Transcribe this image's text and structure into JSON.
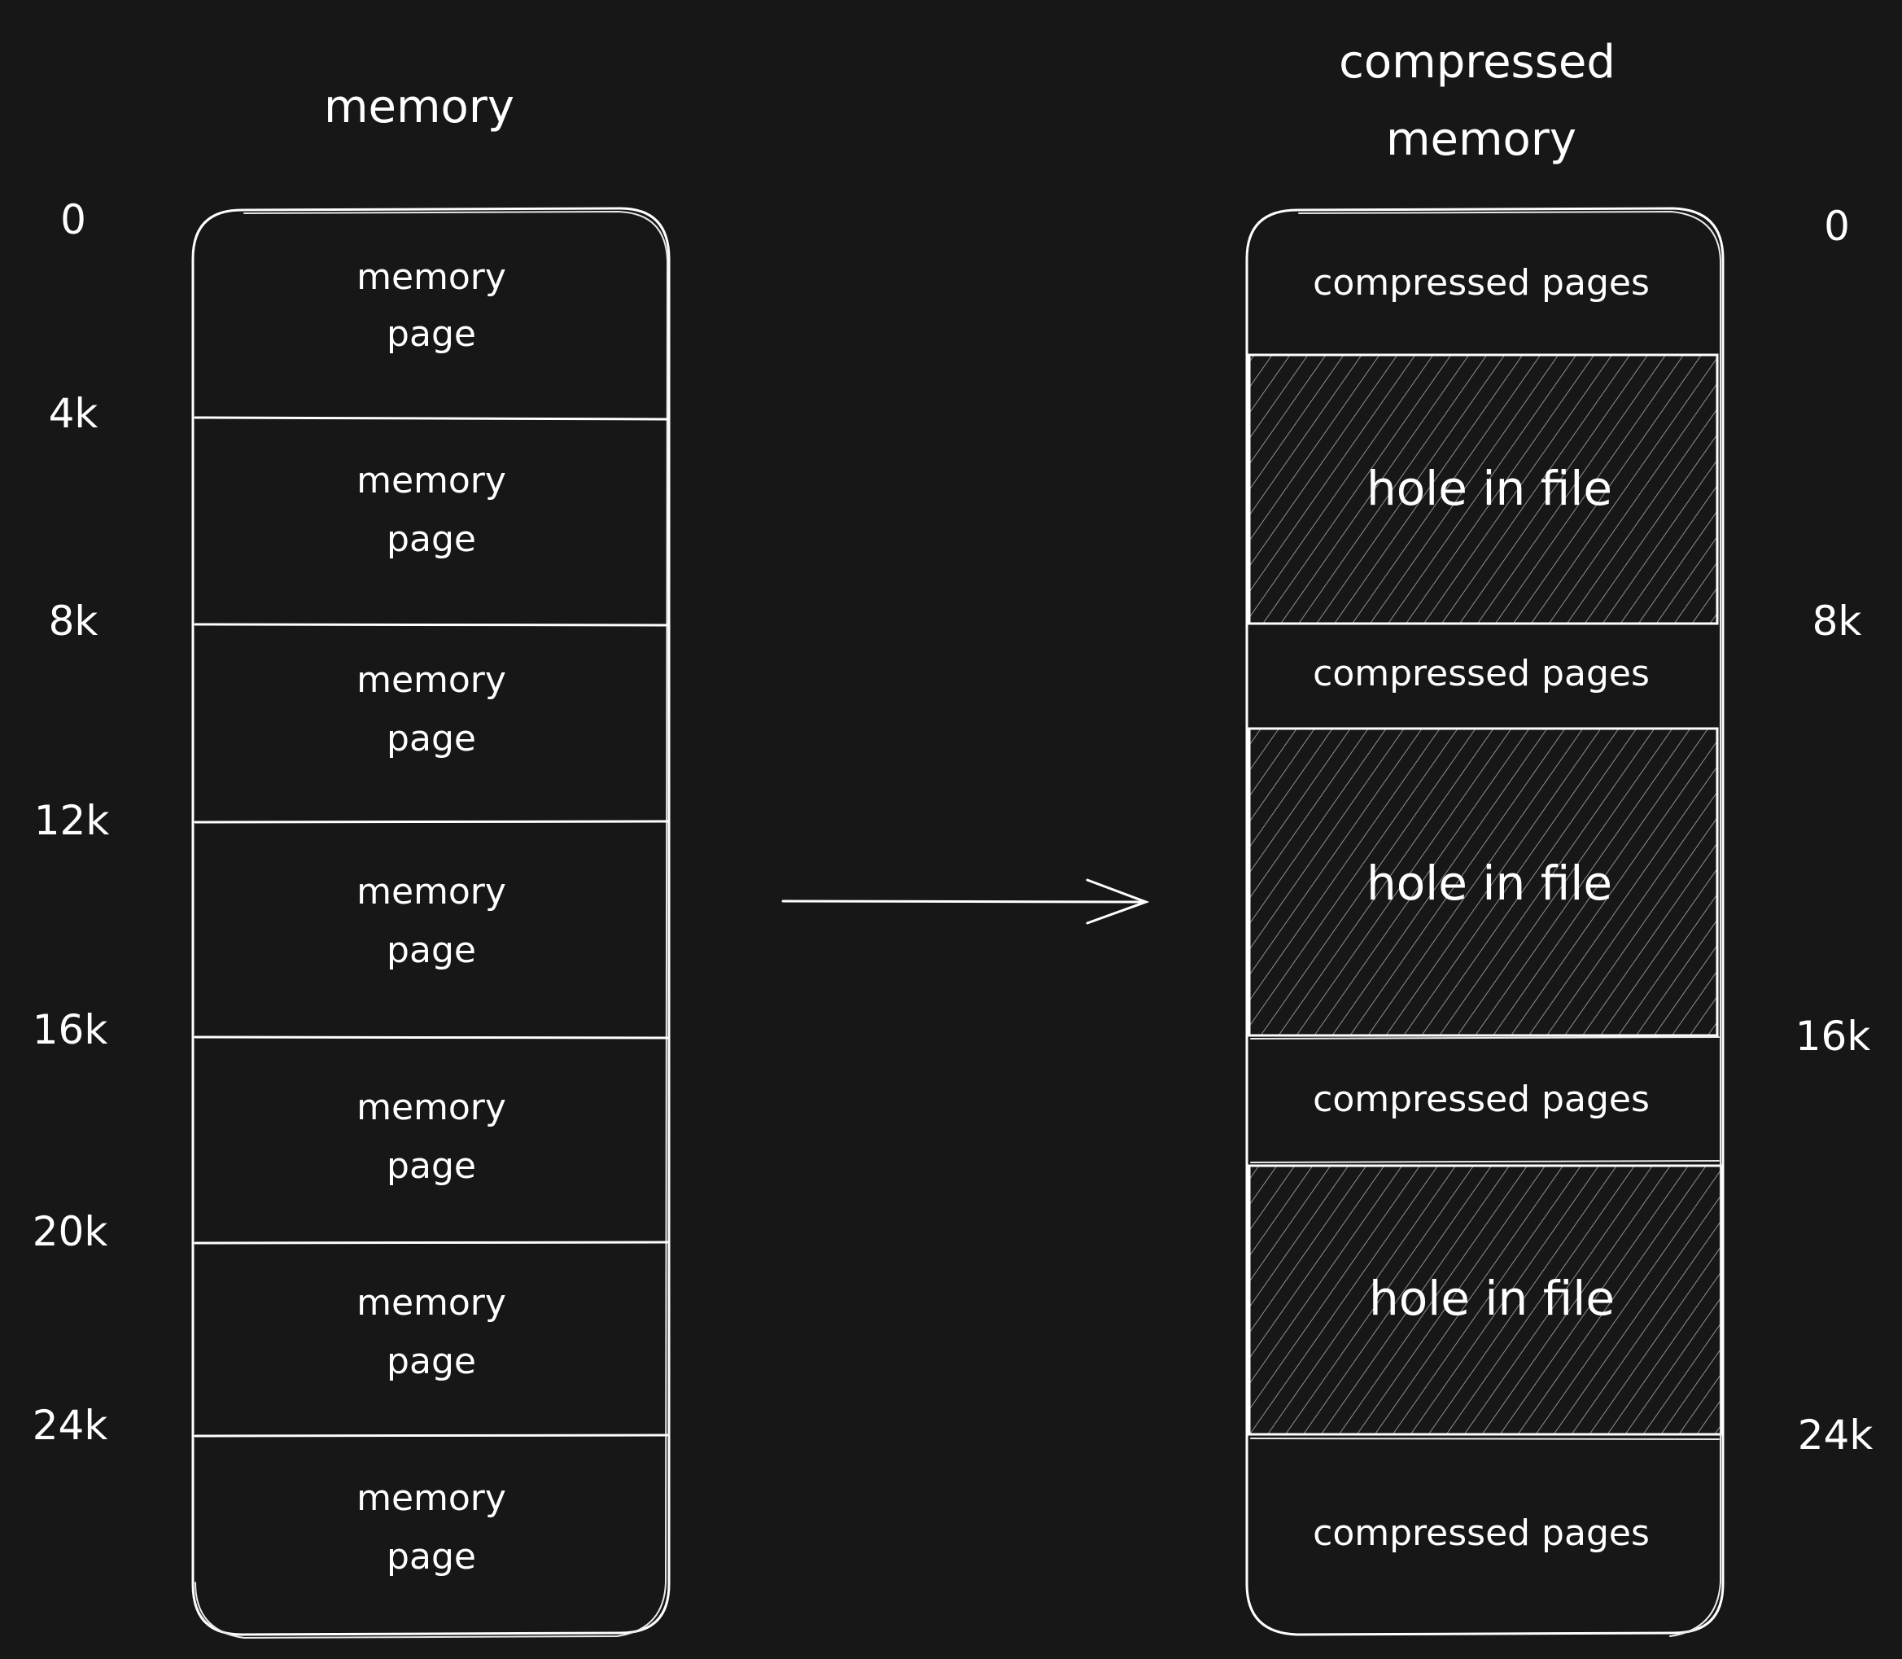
{
  "left_panel": {
    "title": "memory",
    "cells": [
      {
        "line1": "memory",
        "line2": "page"
      },
      {
        "line1": "memory",
        "line2": "page"
      },
      {
        "line1": "memory",
        "line2": "page"
      },
      {
        "line1": "memory",
        "line2": "page"
      },
      {
        "line1": "memory",
        "line2": "page"
      },
      {
        "line1": "memory",
        "line2": "page"
      },
      {
        "line1": "memory",
        "line2": "page"
      }
    ],
    "offsets": [
      "0",
      "4k",
      "8k",
      "12k",
      "16k",
      "20k",
      "24k"
    ]
  },
  "arrow": {
    "direction": "right"
  },
  "right_panel": {
    "title_line1": "compressed",
    "title_line2": "memory",
    "segments": [
      {
        "type": "compressed",
        "label": "compressed pages"
      },
      {
        "type": "hole",
        "label": "hole in file"
      },
      {
        "type": "compressed",
        "label": "compressed pages"
      },
      {
        "type": "hole",
        "label": "hole in file"
      },
      {
        "type": "compressed",
        "label": "compressed pages"
      },
      {
        "type": "hole",
        "label": "hole in file"
      },
      {
        "type": "compressed",
        "label": "compressed pages"
      }
    ],
    "offsets": [
      "0",
      "8k",
      "16k",
      "24k"
    ]
  },
  "colors": {
    "background": "#171717",
    "stroke": "#ffffff",
    "hatch": "#8a8f96"
  }
}
